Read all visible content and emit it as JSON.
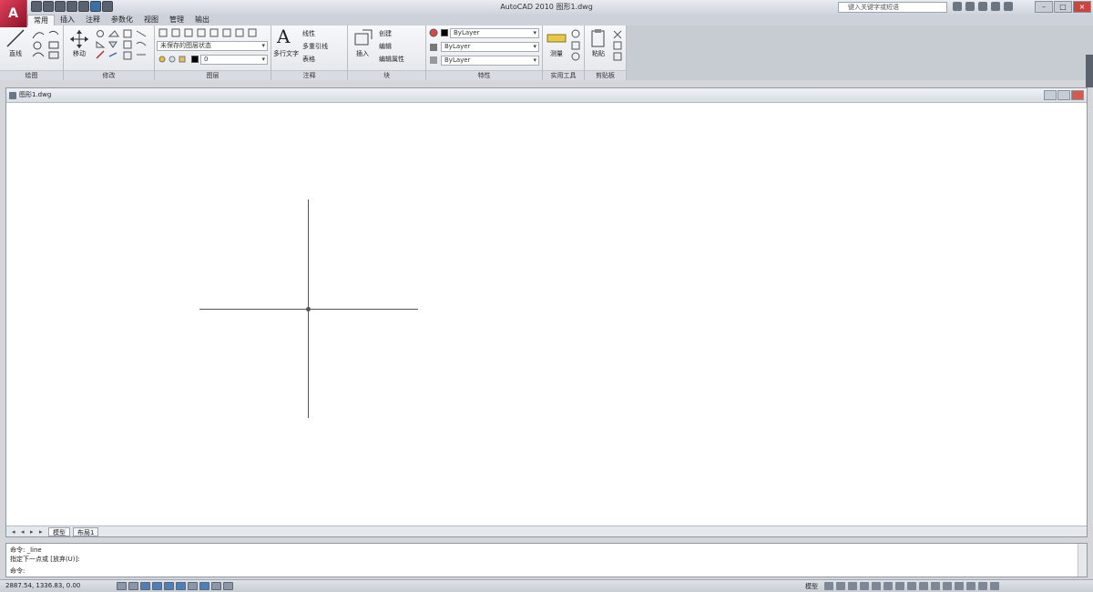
{
  "window": {
    "title": "AutoCAD 2010   图形1.dwg",
    "logo": "A",
    "search_placeholder": "键入关键字或短语"
  },
  "ribbon_tabs": [
    {
      "label": "常用",
      "active": true
    },
    {
      "label": "插入",
      "active": false
    },
    {
      "label": "注释",
      "active": false
    },
    {
      "label": "参数化",
      "active": false
    },
    {
      "label": "视图",
      "active": false
    },
    {
      "label": "管理",
      "active": false
    },
    {
      "label": "输出",
      "active": false
    }
  ],
  "panels": {
    "draw": {
      "title": "绘图",
      "big_label": "直线"
    },
    "modify": {
      "title": "修改",
      "big_label": "移动"
    },
    "layers": {
      "title": "图层",
      "combo": "未保存的图层状态",
      "layer_combo": "0"
    },
    "annotation": {
      "title": "注释",
      "big_label": "多行文字",
      "item1": "线性",
      "item2": "多重引线",
      "item3": "表格"
    },
    "block": {
      "title": "块",
      "big_label": "插入",
      "item1": "创建",
      "item2": "编辑",
      "item3": "编辑属性"
    },
    "properties": {
      "title": "特性",
      "color_combo": "ByLayer",
      "linetype_combo": "ByLayer",
      "lineweight_combo": "ByLayer"
    },
    "utilities": {
      "title": "实用工具",
      "big_label": "测量"
    },
    "clipboard": {
      "title": "剪贴板",
      "big_label": "粘贴"
    }
  },
  "drawing": {
    "tab_title": "图形1.dwg",
    "layout_tabs": [
      {
        "label": "模型",
        "active": true
      },
      {
        "label": "布局1",
        "active": false
      }
    ]
  },
  "command": {
    "line1": "命令: _line",
    "line2": "指定下一点或 [放弃(U)]:",
    "line3": "命令:"
  },
  "status": {
    "coords": "2887.54, 1336.83, 0.00",
    "model_label": "模型"
  }
}
